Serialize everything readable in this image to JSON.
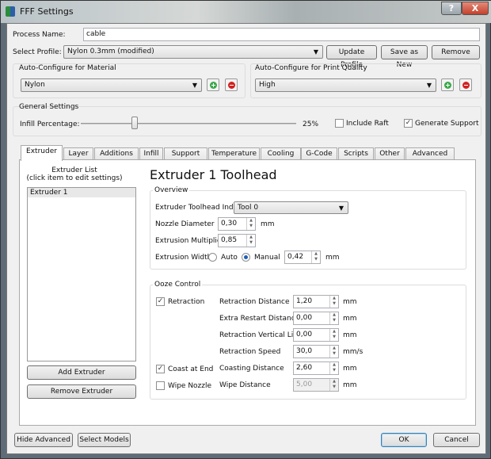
{
  "window": {
    "title": "FFF Settings",
    "help": "?",
    "close": "X"
  },
  "process": {
    "label": "Process Name:",
    "value": "cable"
  },
  "profile": {
    "label": "Select Profile:",
    "value": "Nylon 0.3mm (modified)",
    "update": "Update Profile",
    "save_new": "Save as New",
    "remove": "Remove"
  },
  "material": {
    "label": "Auto-Configure for Material",
    "value": "Nylon"
  },
  "quality": {
    "label": "Auto-Configure for Print Quality",
    "value": "High"
  },
  "general": {
    "label": "General Settings",
    "infill_label": "Infill Percentage:",
    "infill_value": "25%",
    "infill_percent": 25,
    "raft": "Include Raft",
    "raft_checked": false,
    "support": "Generate Support",
    "support_checked": true
  },
  "tabs": [
    "Extruder",
    "Layer",
    "Additions",
    "Infill",
    "Support",
    "Temperature",
    "Cooling",
    "G-Code",
    "Scripts",
    "Other",
    "Advanced"
  ],
  "extruder_list": {
    "title": "Extruder List",
    "hint": "(click item to edit settings)",
    "items": [
      "Extruder 1"
    ],
    "add": "Add Extruder",
    "remove": "Remove Extruder"
  },
  "toolhead": {
    "title": "Extruder 1 Toolhead"
  },
  "overview": {
    "label": "Overview",
    "index_label": "Extruder Toolhead Index",
    "index_value": "Tool 0",
    "nozzle_label": "Nozzle Diameter",
    "nozzle_value": "0,30",
    "nozzle_unit": "mm",
    "mult_label": "Extrusion Multiplier",
    "mult_value": "0,85",
    "width_label": "Extrusion Width",
    "auto": "Auto",
    "manual": "Manual",
    "width_value": "0,42",
    "width_unit": "mm"
  },
  "ooze": {
    "label": "Ooze Control",
    "retraction": "Retraction",
    "coast": "Coast at End",
    "wipe": "Wipe Nozzle",
    "rows": [
      {
        "label": "Retraction Distance",
        "value": "1,20",
        "unit": "mm"
      },
      {
        "label": "Extra Restart Distance",
        "value": "0,00",
        "unit": "mm"
      },
      {
        "label": "Retraction Vertical Lift",
        "value": "0,00",
        "unit": "mm"
      },
      {
        "label": "Retraction Speed",
        "value": "30,0",
        "unit": "mm/s"
      },
      {
        "label": "Coasting Distance",
        "value": "2,60",
        "unit": "mm"
      },
      {
        "label": "Wipe Distance",
        "value": "5,00",
        "unit": "mm"
      }
    ]
  },
  "footer": {
    "hide_advanced": "Hide Advanced",
    "select_models": "Select Models",
    "ok": "OK",
    "cancel": "Cancel"
  },
  "colors": {
    "plus": "#3aa84a",
    "minus": "#d42020",
    "accent": "#1e5fb3"
  }
}
